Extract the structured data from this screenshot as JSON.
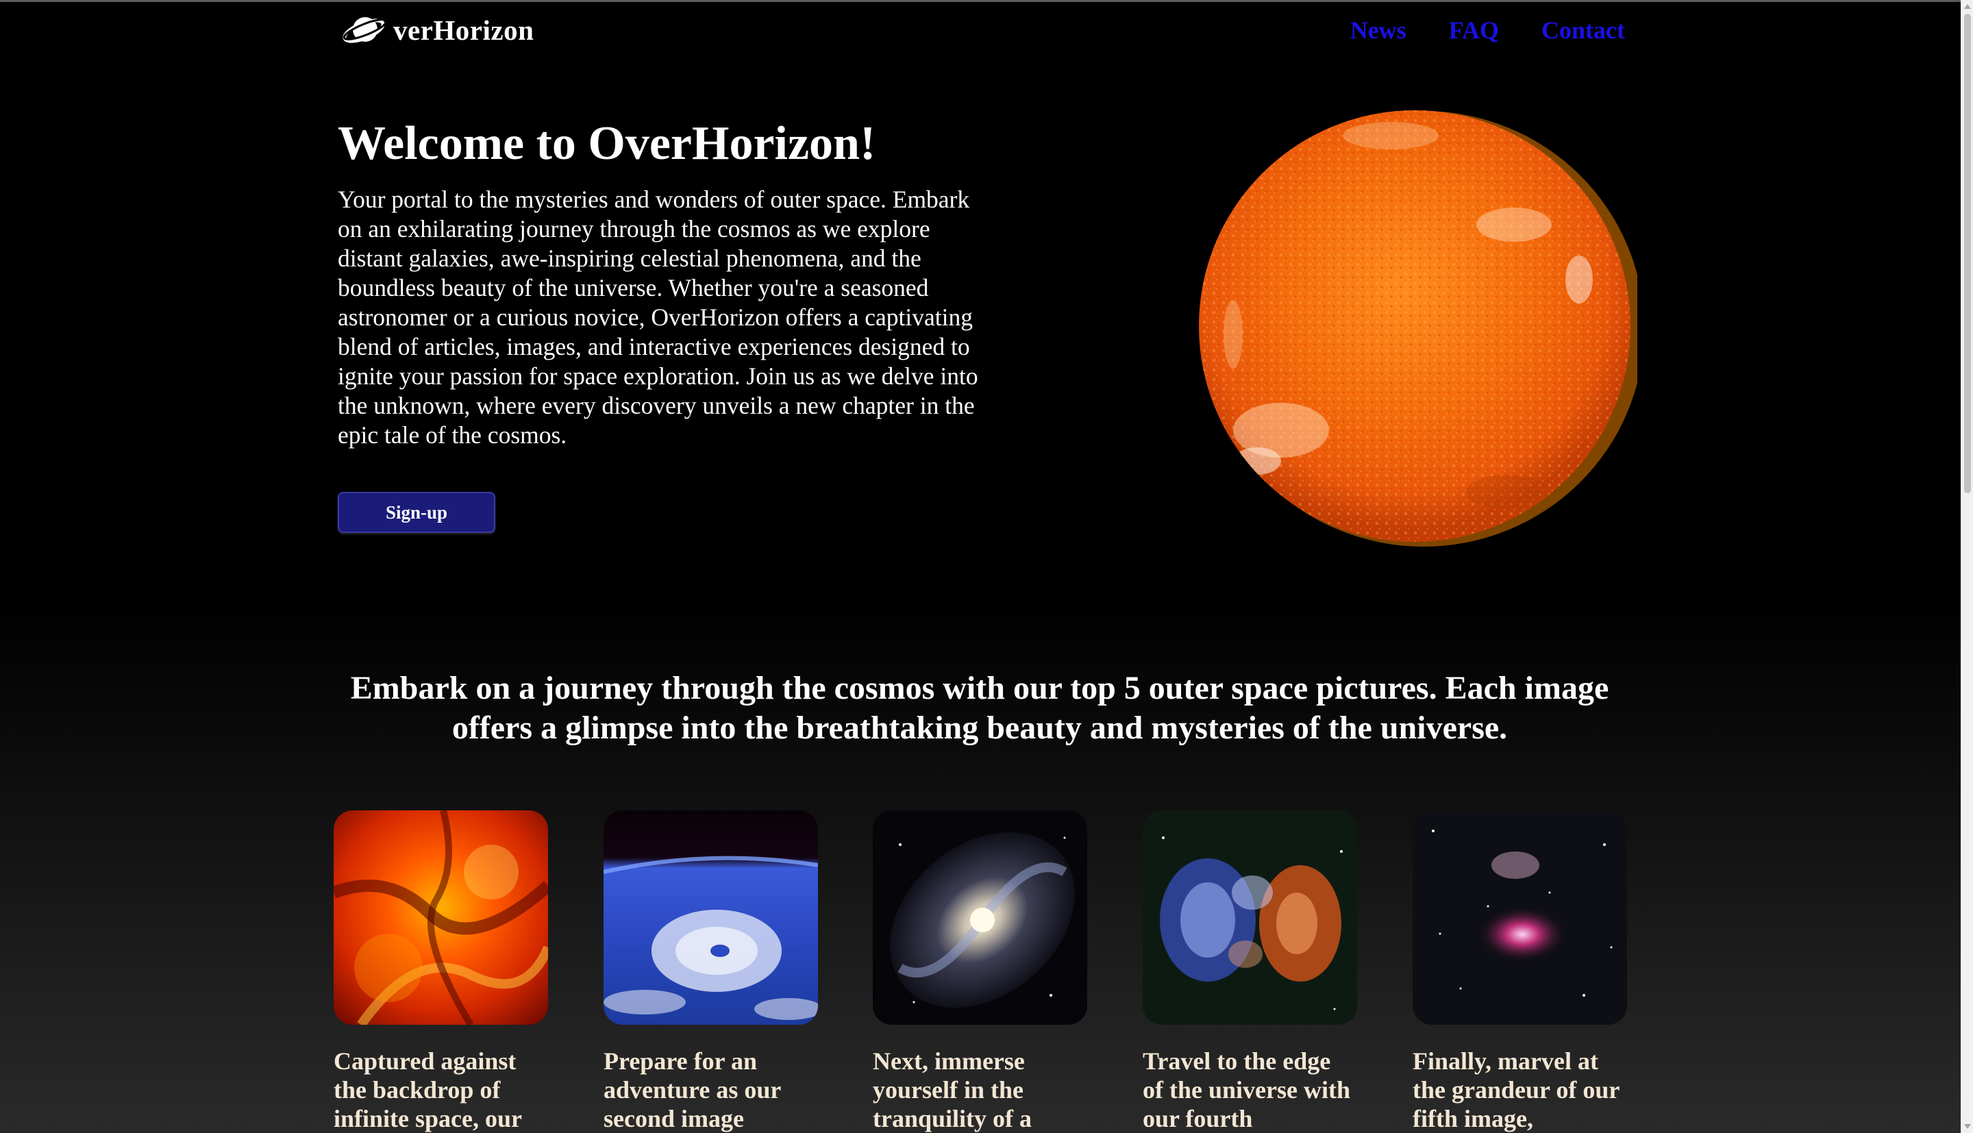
{
  "header": {
    "logo_icon": "planet-ring-icon",
    "logo_text": "verHorizon",
    "nav": [
      {
        "label": "News"
      },
      {
        "label": "FAQ"
      },
      {
        "label": "Contact"
      }
    ],
    "nav_color": "#1a10e6"
  },
  "hero": {
    "title": "Welcome to OverHorizon!",
    "text": "Your portal to the mysteries and wonders of outer space. Embark on an exhilarating journey through the cosmos as we explore distant galaxies, awe-inspiring celestial phenomena, and the boundless beauty of the universe. Whether you're a seasoned astronomer or a curious novice, OverHorizon offers a captivating blend of articles, images, and interactive experiences designed to ignite your passion for space exploration. Join us as we delve into the unknown, where every discovery unveils a new chapter in the epic tale of the cosmos.",
    "signup_label": "Sign-up",
    "image": "sun-image"
  },
  "tagline": "Embark on a journey through the cosmos with our top 5 outer space pictures. Each image offers a glimpse into the breathtaking beauty and mysteries of the universe.",
  "gallery": [
    {
      "image": "red-nebula-image",
      "caption": "Captured against the backdrop of infinite space, our"
    },
    {
      "image": "earth-hurricane-image",
      "caption": "Prepare for an adventure as our second image"
    },
    {
      "image": "spiral-galaxy-image",
      "caption": "Next, immerse yourself in the tranquility of a"
    },
    {
      "image": "galaxy-cluster-image",
      "caption": "Travel to the edge of the universe with our fourth"
    },
    {
      "image": "orion-nebula-image",
      "caption": "Finally, marvel at the grandeur of our fifth image,"
    }
  ],
  "colors": {
    "background": "#000000",
    "button": "#1b1b7a",
    "caption": "#f3e7d4"
  }
}
